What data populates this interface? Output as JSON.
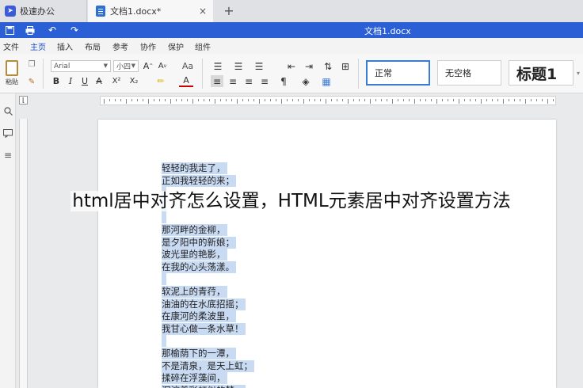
{
  "tabs": {
    "app_label": "极速办公",
    "doc_label": "文档1.docx*",
    "close_glyph": "×",
    "new_glyph": "+"
  },
  "titlebar": {
    "title": "文档1.docx",
    "icons": [
      "save-icon",
      "print-icon",
      "undo-icon",
      "redo-icon"
    ],
    "color": "#2b5fd6"
  },
  "menu": {
    "items": [
      "文件",
      "主页",
      "插入",
      "布局",
      "参考",
      "协作",
      "保护",
      "组件"
    ],
    "active": "主页"
  },
  "ribbon": {
    "paste_label": "粘贴",
    "font_name": "Arial",
    "font_size": "小四",
    "styles": [
      "正常",
      "无空格",
      "标题1"
    ]
  },
  "document": {
    "lines": [
      "轻轻的我走了，",
      "正如我轻轻的来；",
      "",
      "",
      "",
      "那河畔的金柳，",
      "是夕阳中的新娘；",
      "波光里的艳影，",
      "在我的心头荡漾。",
      "",
      "软泥上的青荇，",
      "油油的在水底招摇；",
      "在康河的柔波里，",
      "我甘心做一条水草！",
      "",
      "那榆荫下的一潭，",
      "不是清泉，是天上虹；",
      "揉碎在浮藻间，",
      "沉淀着彩虹似的梦。"
    ]
  },
  "overlay": {
    "caption": "html居中对齐怎么设置，HTML元素居中对齐设置方法"
  }
}
